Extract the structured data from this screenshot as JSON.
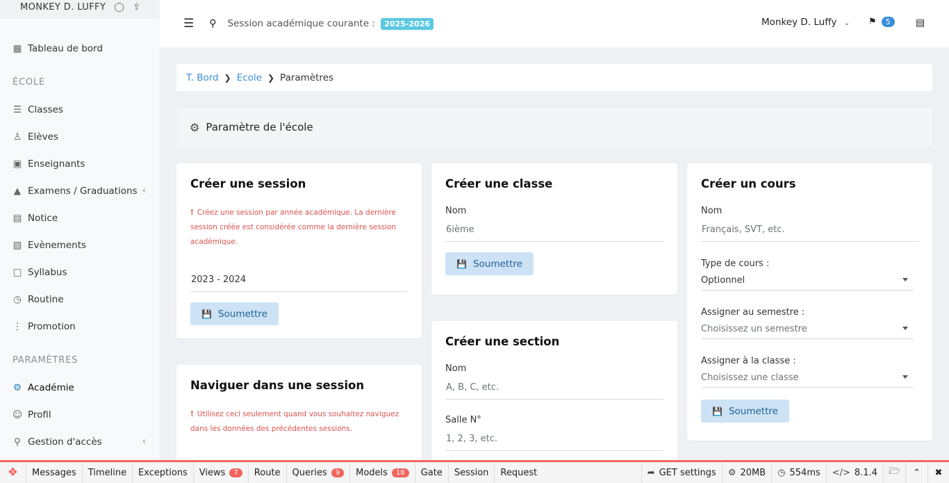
{
  "sidebar": {
    "user_name": "MONKEY D. LUFFY",
    "items": [
      {
        "label": "Tableau de bord",
        "icon": "dashboard-icon"
      }
    ],
    "section_ecole": "ÉCOLE",
    "ecole_items": [
      {
        "label": "Classes",
        "icon": "layers-icon"
      },
      {
        "label": "Elèves",
        "icon": "students-icon"
      },
      {
        "label": "Enseignants",
        "icon": "teachers-icon"
      },
      {
        "label": "Examens / Graduations",
        "icon": "graduation-icon"
      },
      {
        "label": "Notice",
        "icon": "notice-icon"
      },
      {
        "label": "Evènements",
        "icon": "calendar-icon"
      },
      {
        "label": "Syllabus",
        "icon": "syllabus-icon"
      },
      {
        "label": "Routine",
        "icon": "routine-icon"
      },
      {
        "label": "Promotion",
        "icon": "sliders-icon"
      }
    ],
    "section_params": "PARAMÈTRES",
    "param_items": [
      {
        "label": "Académie",
        "icon": "gear-icon"
      },
      {
        "label": "Profil",
        "icon": "person-icon"
      },
      {
        "label": "Gestion d'accès",
        "icon": "key-icon"
      }
    ]
  },
  "topbar": {
    "session_label": "Session académique courante :",
    "session_value": "2025-2026",
    "user": "Monkey D. Luffy",
    "notif_count": "5"
  },
  "breadcrumb": {
    "items": [
      "T. Bord",
      "Ecole"
    ],
    "current": "Paramètres"
  },
  "page_title": "Paramètre de l'école",
  "cards": {
    "session": {
      "title": "Créer une session",
      "notice": "Créez une session par année académique. La dernière session créée est considérée comme la dernière session académique.",
      "input_value": "2023 - 2024",
      "button": "Soumettre"
    },
    "navigate": {
      "title": "Naviguer dans une session",
      "notice": "Utilisez ceci seulement quand vous souhaitez naviguez dans les données des précédentes sessions."
    },
    "classe": {
      "title": "Créer une classe",
      "name_label": "Nom",
      "name_placeholder": "6ième",
      "button": "Soumettre"
    },
    "section": {
      "title": "Créer une section",
      "name_label": "Nom",
      "name_placeholder": "A, B, C, etc.",
      "room_label": "Salle N°",
      "room_placeholder": "1, 2, 3, etc."
    },
    "cours": {
      "title": "Créer un cours",
      "name_label": "Nom",
      "name_placeholder": "Français, SVT, etc.",
      "type_label": "Type de cours :",
      "type_value": "Optionnel",
      "semestre_label": "Assigner au semestre :",
      "semestre_value": "Choisissez un semestre",
      "classe_label": "Assigner à la classe :",
      "classe_value": "Choisissez une classe",
      "button": "Soumettre"
    }
  },
  "debugbar": {
    "tabs": [
      {
        "label": "Messages"
      },
      {
        "label": "Timeline"
      },
      {
        "label": "Exceptions"
      },
      {
        "label": "Views",
        "count": "7"
      },
      {
        "label": "Route"
      },
      {
        "label": "Queries",
        "count": "9"
      },
      {
        "label": "Models",
        "count": "18"
      },
      {
        "label": "Gate"
      },
      {
        "label": "Session"
      },
      {
        "label": "Request"
      }
    ],
    "route": "GET settings",
    "memory": "20MB",
    "time": "554ms",
    "php": "8.1.4"
  }
}
